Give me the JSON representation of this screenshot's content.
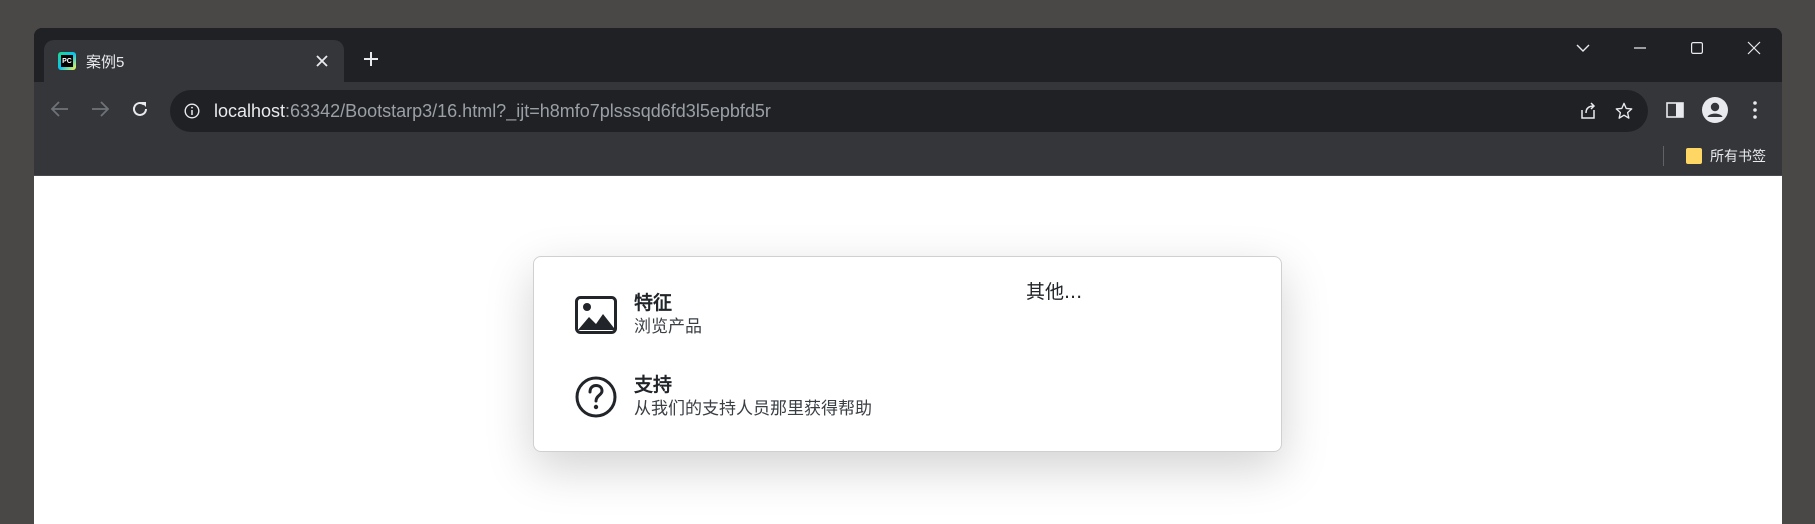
{
  "tab": {
    "title": "案例5"
  },
  "address": {
    "host": "localhost",
    "rest": ":63342/Bootstarp3/16.html?_ijt=h8mfo7plsssqd6fd3l5epbfd5r"
  },
  "bookmarks": {
    "all_label": "所有书签"
  },
  "dropdown": {
    "items": [
      {
        "title": "特征",
        "desc": "浏览产品",
        "icon": "image-icon"
      },
      {
        "title": "支持",
        "desc": "从我们的支持人员那里获得帮助",
        "icon": "question-circle-icon"
      }
    ],
    "other_label": "其他..."
  },
  "colors": {
    "chrome_dark": "#202124",
    "chrome_toolbar": "#35363a",
    "text_light": "#e8eaed",
    "folder": "#fdd663"
  }
}
